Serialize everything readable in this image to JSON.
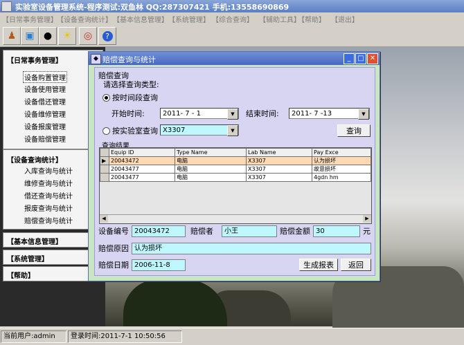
{
  "app": {
    "title": "实验室设备管理系统-程序测试:双鱼林  QQ:287307421 手机:13558690869"
  },
  "menu": [
    "【日常事务管理】",
    "【设备查询统计】",
    "【基本信息管理】",
    "【系统管理】",
    "【综合查询】",
    "【辅助工具】",
    "【帮助】",
    "【退出】"
  ],
  "toolbar_icons": [
    "people-icon",
    "monitor-globe-icon",
    "penguin-icon",
    "lightbulb-icon",
    "target-icon",
    "help-icon"
  ],
  "sidebar": {
    "daily": {
      "title": "【日常事务管理】",
      "items": [
        "设备购置管理",
        "设备使用管理",
        "设备借还管理",
        "设备维修管理",
        "设备报废管理",
        "设备赔偿管理"
      ]
    },
    "query": {
      "title": "【设备查询统计】",
      "items": [
        "入库查询与统计",
        "维修查询与统计",
        "借还查询与统计",
        "报废查询与统计",
        "赔偿查询与统计"
      ]
    },
    "basic": {
      "title": "【基本信息管理】"
    },
    "system": {
      "title": "【系统管理】"
    },
    "help": {
      "title": "【帮助】"
    }
  },
  "status": {
    "user": "当前用户:admin",
    "login_time": "登录时间:2011-7-1 10:50:56"
  },
  "dialog": {
    "title": "赔偿查询与统计",
    "section_query": "赔偿查询",
    "prompt": "请选择查询类型:",
    "radio_time": "按时间段查询",
    "start_label": "开始时间:",
    "start_value": "2011- 7 - 1",
    "end_label": "结束时间:",
    "end_value": "2011- 7 -13",
    "radio_lab": "按实验室查询",
    "lab_value": "X3307",
    "query_button": "查询",
    "section_result": "查询结果",
    "table": {
      "columns": [
        "Equip ID",
        "Type Name",
        "Lab Name",
        "Pay Exce"
      ],
      "rows": [
        [
          "20043472",
          "电脑",
          "X3307",
          "认为损坏"
        ],
        [
          "20043477",
          "电脑",
          "X3307",
          "故意损坏"
        ],
        [
          "20043477",
          "电脑",
          "X3307",
          "4gdn hm"
        ]
      ]
    },
    "equip_label": "设备编号",
    "equip_value": "20043472",
    "payer_label": "赔偿者",
    "payer_value": "小王",
    "amount_label": "赔偿金额",
    "amount_value": "30",
    "amount_unit": "元",
    "reason_label": "赔偿原因",
    "reason_value": "认为损坏",
    "date_label": "赔偿日期",
    "date_value": "2006-11-8",
    "report_button": "生成报表",
    "back_button": "返回"
  }
}
